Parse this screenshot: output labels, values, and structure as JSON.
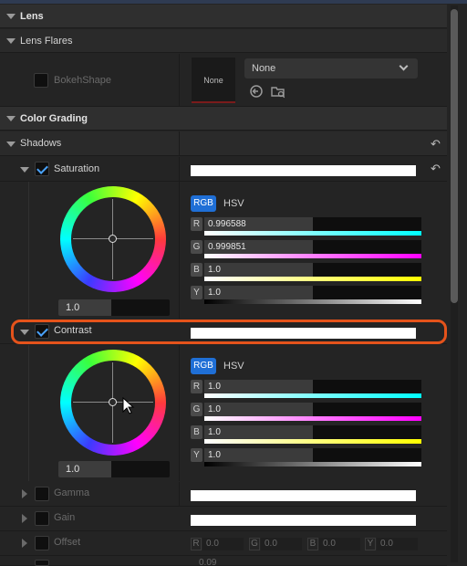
{
  "sections": {
    "lens": "Lens",
    "lens_flares": "Lens Flares",
    "color_grading": "Color Grading",
    "shadows": "Shadows"
  },
  "bokeh": {
    "label": "BokehShape",
    "thumbnail_text": "None",
    "dropdown_value": "None",
    "icons": [
      "back-arrow-icon",
      "browse-folder-icon"
    ]
  },
  "saturation": {
    "label": "Saturation",
    "checked": true,
    "wheel_value": "1.0",
    "mode_rgb": "RGB",
    "mode_hsv": "HSV",
    "channels": [
      {
        "letter": "R",
        "value": "0.996588",
        "level": 0.5
      },
      {
        "letter": "G",
        "value": "0.999851",
        "level": 0.5
      },
      {
        "letter": "B",
        "value": "1.0",
        "level": 0.5
      },
      {
        "letter": "Y",
        "value": "1.0",
        "level": 0.5
      }
    ]
  },
  "contrast": {
    "label": "Contrast",
    "checked": true,
    "wheel_value": "1.0",
    "mode_rgb": "RGB",
    "mode_hsv": "HSV",
    "channels": [
      {
        "letter": "R",
        "value": "1.0",
        "level": 0.5
      },
      {
        "letter": "G",
        "value": "1.0",
        "level": 0.5
      },
      {
        "letter": "B",
        "value": "1.0",
        "level": 0.5
      },
      {
        "letter": "Y",
        "value": "1.0",
        "level": 0.5
      }
    ]
  },
  "gamma": {
    "label": "Gamma"
  },
  "gain": {
    "label": "Gain"
  },
  "offset": {
    "label": "Offset",
    "channels": [
      {
        "letter": "R",
        "value": "0.0"
      },
      {
        "letter": "G",
        "value": "0.0"
      },
      {
        "letter": "B",
        "value": "0.0"
      },
      {
        "letter": "Y",
        "value": "0.0"
      }
    ]
  },
  "shadows_max": {
    "value": "0.09"
  },
  "colors": {
    "accent": "#1f6fd6",
    "highlight": "#e5531b",
    "check": "#4aa3ff"
  }
}
